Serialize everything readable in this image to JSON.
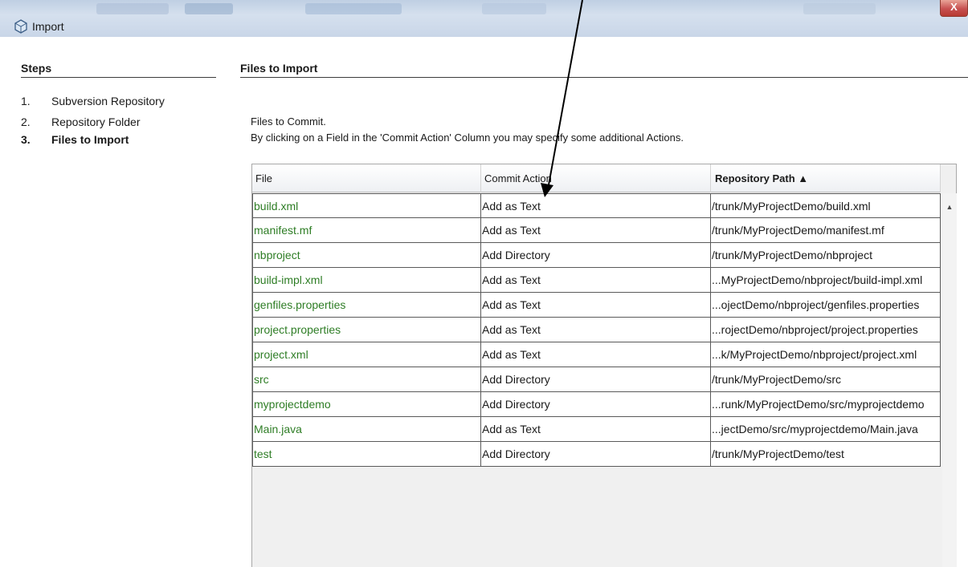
{
  "window": {
    "title": "Import",
    "close_label": "X"
  },
  "steps": {
    "heading": "Steps",
    "items": [
      {
        "num": "1.",
        "label": "Subversion Repository",
        "active": false
      },
      {
        "num": "2.",
        "label": "Repository Folder",
        "active": false
      },
      {
        "num": "3.",
        "label": "Files to Import",
        "active": true
      }
    ]
  },
  "main": {
    "heading": "Files to Import",
    "line1": "Files to Commit.",
    "line2": "By clicking on a Field in the 'Commit Action' Column you may specify some additional Actions."
  },
  "table": {
    "columns": [
      "File",
      "Commit Action",
      "Repository Path ▲"
    ],
    "sorted_column": 2,
    "rows": [
      [
        "build.xml",
        "Add as Text",
        "/trunk/MyProjectDemo/build.xml"
      ],
      [
        "manifest.mf",
        "Add as Text",
        "/trunk/MyProjectDemo/manifest.mf"
      ],
      [
        "nbproject",
        "Add Directory",
        "/trunk/MyProjectDemo/nbproject"
      ],
      [
        "build-impl.xml",
        "Add as Text",
        "...MyProjectDemo/nbproject/build-impl.xml"
      ],
      [
        "genfiles.properties",
        "Add as Text",
        "...ojectDemo/nbproject/genfiles.properties"
      ],
      [
        "project.properties",
        "Add as Text",
        "...rojectDemo/nbproject/project.properties"
      ],
      [
        "project.xml",
        "Add as Text",
        "...k/MyProjectDemo/nbproject/project.xml"
      ],
      [
        "src",
        "Add Directory",
        "/trunk/MyProjectDemo/src"
      ],
      [
        "myprojectdemo",
        "Add Directory",
        "...runk/MyProjectDemo/src/myprojectdemo"
      ],
      [
        "Main.java",
        "Add as Text",
        "...jectDemo/src/myprojectdemo/Main.java"
      ],
      [
        "test",
        "Add Directory",
        "/trunk/MyProjectDemo/test"
      ]
    ]
  },
  "scroll_up_symbol": "▲",
  "colors": {
    "file_name": "#2e7d25",
    "close_button": "#c75050",
    "titlebar": "#c9d6e8"
  }
}
